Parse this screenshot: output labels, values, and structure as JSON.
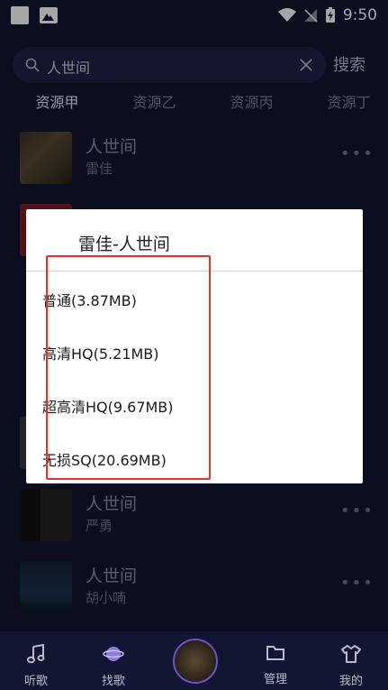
{
  "statusbar": {
    "time": "9:50"
  },
  "search": {
    "query": "人世间",
    "button": "搜索"
  },
  "tabs": [
    {
      "label": "资源甲"
    },
    {
      "label": "资源乙"
    },
    {
      "label": "资源丙"
    },
    {
      "label": "资源丁"
    }
  ],
  "songs": [
    {
      "title": "人世间",
      "artist": "雷佳"
    },
    {
      "title": "人世间",
      "artist": "严勇"
    },
    {
      "title": "人世间",
      "artist": "胡小喃"
    }
  ],
  "dialog": {
    "title": "雷佳-人世间",
    "options": [
      {
        "label": "普通(3.87MB)"
      },
      {
        "label": "高清HQ(5.21MB)"
      },
      {
        "label": "超高清HQ(9.67MB)"
      },
      {
        "label": "无损SQ(20.69MB)"
      }
    ]
  },
  "nav": [
    {
      "label": "听歌",
      "icon": "music-note-icon"
    },
    {
      "label": "找歌",
      "icon": "planet-icon"
    },
    {
      "label": "管理",
      "icon": "folder-icon"
    },
    {
      "label": "我的",
      "icon": "shirt-icon"
    }
  ],
  "colors": {
    "background": "#131632",
    "highlight": "#e0332a",
    "accent": "#6a56c9"
  }
}
